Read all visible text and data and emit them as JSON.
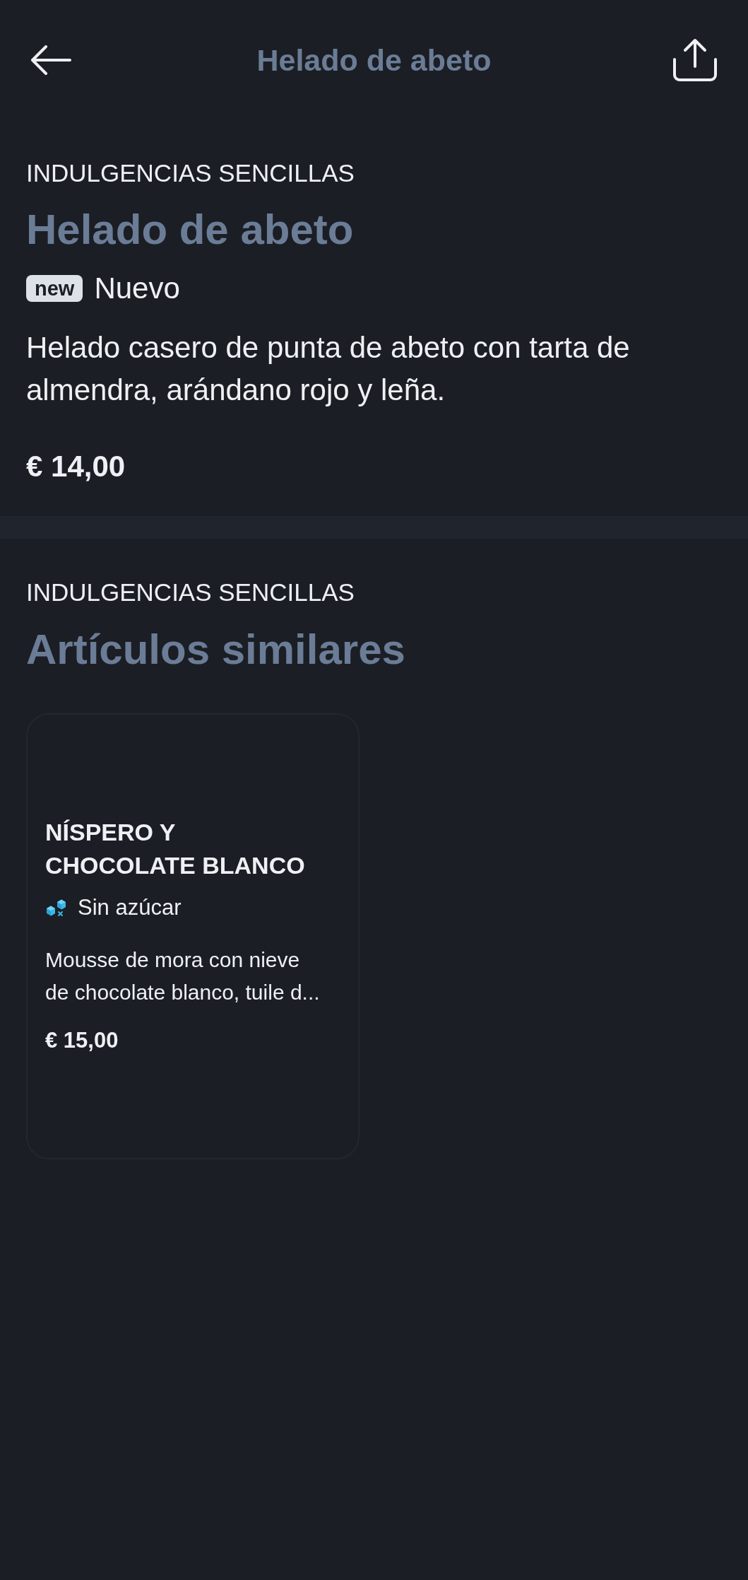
{
  "top_bar": {
    "title": "Helado de abeto"
  },
  "product": {
    "category": "INDULGENCIAS SENCILLAS",
    "name": "Helado de abeto",
    "badges": [
      {
        "tag": "new",
        "label": "Nuevo"
      }
    ],
    "description": "Helado casero de punta de abeto con tarta de almendra, arándano rojo y leña.",
    "price": "€ 14,00"
  },
  "similar": {
    "category": "INDULGENCIAS SENCILLAS",
    "title": "Artículos similares",
    "items": [
      {
        "name": "NÍSPERO Y CHOCOLATE BLANCO",
        "labels": [
          "Sin azúcar"
        ],
        "description": "Mousse de mora con nieve de chocolate blanco, tuile d...",
        "price": "€ 15,00"
      }
    ]
  }
}
